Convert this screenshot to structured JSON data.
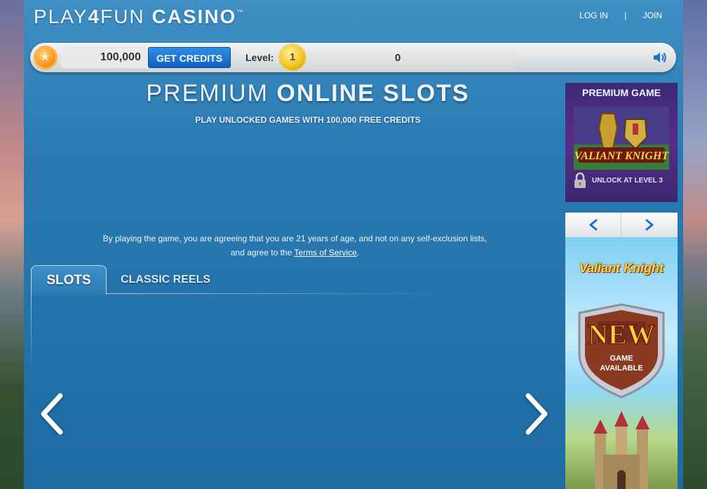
{
  "header": {
    "logo": {
      "light": "PLAY",
      "bold": "4",
      "light2": "FUN",
      "casino": "CASINO",
      "tm": "™"
    },
    "login_label": "LOG IN",
    "separator": "|",
    "join_label": "JOIN"
  },
  "status_bar": {
    "credits": "100,000",
    "get_credits_label": "GET CREDITS",
    "level_label": "Level:",
    "level": "1",
    "level_progress": "0",
    "sound_icon": "speaker-icon"
  },
  "hero": {
    "title_light": "PREMIUM ",
    "title_bold": "ONLINE SLOTS",
    "subtitle": "PLAY UNLOCKED GAMES WITH 100,000 FREE CREDITS",
    "disclaimer_line1": "By playing the game, you are agreeing that you are 21 years of age, and not on any self-exclusion lists,",
    "disclaimer_line2_prefix": "and agree to the ",
    "terms_link": "Terms of Service",
    "disclaimer_line2_suffix": "."
  },
  "tabs": [
    {
      "label": "SLOTS",
      "active": true
    },
    {
      "label": "CLASSIC REELS",
      "active": false
    }
  ],
  "sidebar": {
    "promo_title": "PREMIUM GAME",
    "promo_game": "VALIANT KNIGHT",
    "promo_unlock": "UNLOCK AT LEVEL 3",
    "ad_logo": "Valiant Knight",
    "ad_badge": "NEW",
    "ad_badge_sub1": "GAME",
    "ad_badge_sub2": "AVAILABLE"
  },
  "colors": {
    "main_blue": "#2b7ab2",
    "button_blue": "#0f5fc0",
    "promo_purple": "#5a2c86",
    "gold": "#f1c21a"
  }
}
